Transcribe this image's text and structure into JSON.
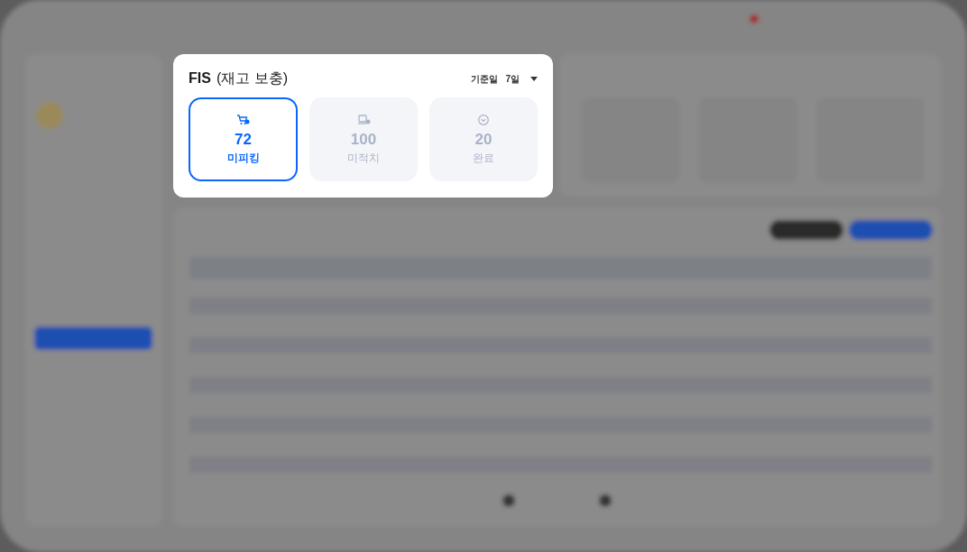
{
  "card": {
    "title": "FIS",
    "subtitle": "(재고 보충)",
    "filter_label": "기준일",
    "filter_value": "7일",
    "tiles": [
      {
        "kind": "cart",
        "value": "72",
        "label": "미피킹",
        "selected": true
      },
      {
        "kind": "device",
        "value": "100",
        "label": "미적치",
        "selected": false
      },
      {
        "kind": "check",
        "value": "20",
        "label": "완료",
        "selected": false
      }
    ]
  }
}
